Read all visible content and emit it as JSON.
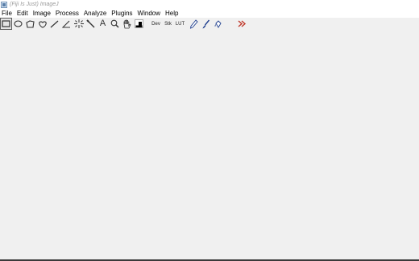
{
  "window": {
    "title": "(Fiji Is Just) ImageJ"
  },
  "menubar": {
    "items": [
      "File",
      "Edit",
      "Image",
      "Process",
      "Analyze",
      "Plugins",
      "Window",
      "Help"
    ]
  },
  "toolbar": {
    "tools": [
      {
        "icon": "rectangle-icon"
      },
      {
        "icon": "oval-icon"
      },
      {
        "icon": "polygon-icon"
      },
      {
        "icon": "freehand-icon"
      },
      {
        "icon": "straight-line-icon"
      },
      {
        "icon": "angle-icon"
      },
      {
        "icon": "point-icon"
      },
      {
        "icon": "wand-icon"
      },
      {
        "icon": "text-icon",
        "label": "A"
      },
      {
        "icon": "magnifier-icon"
      },
      {
        "icon": "hand-icon"
      },
      {
        "icon": "color-picker-icon"
      },
      {
        "icon": "developer-menu-icon",
        "label": "Dev"
      },
      {
        "icon": "stack-menu-icon",
        "label": "Stk"
      },
      {
        "icon": "lut-menu-icon",
        "label": "LUT"
      },
      {
        "icon": "pencil-icon"
      },
      {
        "icon": "brush-icon"
      },
      {
        "icon": "flood-fill-icon"
      },
      {
        "icon": "more-tools-icon"
      }
    ],
    "selected_index": 0
  },
  "colors": {
    "background": "#f0f0f0",
    "selected_border": "#5a5a5a",
    "more_tools": "#c0392b",
    "tool_icon": "#333333"
  }
}
